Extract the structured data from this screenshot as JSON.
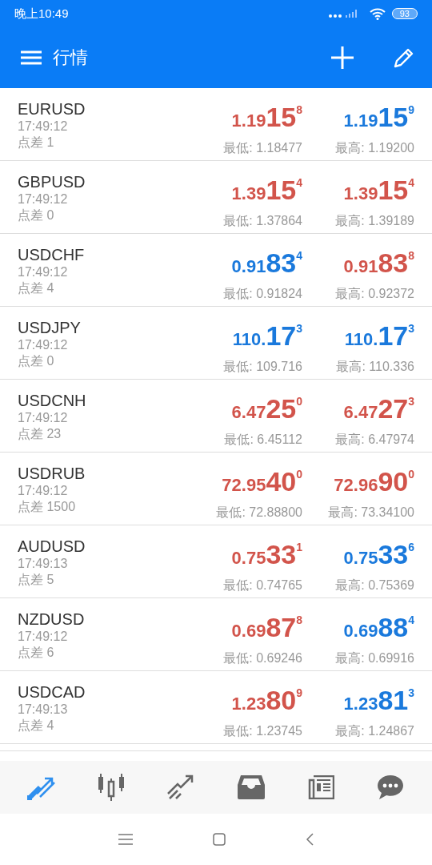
{
  "status_bar": {
    "time": "晚上10:49",
    "battery": "93"
  },
  "app_bar": {
    "title": "行情"
  },
  "quotes": [
    {
      "symbol": "EURUSD",
      "time": "17:49:12",
      "spread": "点差 1",
      "bid": {
        "prefix": "1.19",
        "big": "15",
        "sup": "8",
        "up": false
      },
      "ask": {
        "prefix": "1.19",
        "big": "15",
        "sup": "9",
        "up": true
      },
      "low": "最低: 1.18477",
      "high": "最高: 1.19200"
    },
    {
      "symbol": "GBPUSD",
      "time": "17:49:12",
      "spread": "点差 0",
      "bid": {
        "prefix": "1.39",
        "big": "15",
        "sup": "4",
        "up": false
      },
      "ask": {
        "prefix": "1.39",
        "big": "15",
        "sup": "4",
        "up": false
      },
      "low": "最低: 1.37864",
      "high": "最高: 1.39189"
    },
    {
      "symbol": "USDCHF",
      "time": "17:49:12",
      "spread": "点差 4",
      "bid": {
        "prefix": "0.91",
        "big": "83",
        "sup": "4",
        "up": true
      },
      "ask": {
        "prefix": "0.91",
        "big": "83",
        "sup": "8",
        "up": false
      },
      "low": "最低: 0.91824",
      "high": "最高: 0.92372"
    },
    {
      "symbol": "USDJPY",
      "time": "17:49:12",
      "spread": "点差 0",
      "bid": {
        "prefix": "110.",
        "big": "17",
        "sup": "3",
        "up": true
      },
      "ask": {
        "prefix": "110.",
        "big": "17",
        "sup": "3",
        "up": true
      },
      "low": "最低: 109.716",
      "high": "最高: 110.336"
    },
    {
      "symbol": "USDCNH",
      "time": "17:49:12",
      "spread": "点差 23",
      "bid": {
        "prefix": "6.47",
        "big": "25",
        "sup": "0",
        "up": false
      },
      "ask": {
        "prefix": "6.47",
        "big": "27",
        "sup": "3",
        "up": false
      },
      "low": "最低: 6.45112",
      "high": "最高: 6.47974"
    },
    {
      "symbol": "USDRUB",
      "time": "17:49:12",
      "spread": "点差 1500",
      "bid": {
        "prefix": "72.95",
        "big": "40",
        "sup": "0",
        "up": false
      },
      "ask": {
        "prefix": "72.96",
        "big": "90",
        "sup": "0",
        "up": false
      },
      "low": "最低: 72.88800",
      "high": "最高: 73.34100"
    },
    {
      "symbol": "AUDUSD",
      "time": "17:49:13",
      "spread": "点差 5",
      "bid": {
        "prefix": "0.75",
        "big": "33",
        "sup": "1",
        "up": false
      },
      "ask": {
        "prefix": "0.75",
        "big": "33",
        "sup": "6",
        "up": true
      },
      "low": "最低: 0.74765",
      "high": "最高: 0.75369"
    },
    {
      "symbol": "NZDUSD",
      "time": "17:49:12",
      "spread": "点差 6",
      "bid": {
        "prefix": "0.69",
        "big": "87",
        "sup": "8",
        "up": false
      },
      "ask": {
        "prefix": "0.69",
        "big": "88",
        "sup": "4",
        "up": true
      },
      "low": "最低: 0.69246",
      "high": "最高: 0.69916"
    },
    {
      "symbol": "USDCAD",
      "time": "17:49:13",
      "spread": "点差 4",
      "bid": {
        "prefix": "1.23",
        "big": "80",
        "sup": "9",
        "up": false
      },
      "ask": {
        "prefix": "1.23",
        "big": "81",
        "sup": "3",
        "up": true
      },
      "low": "最低: 1.23745",
      "high": "最高: 1.24867"
    }
  ],
  "bottom_nav": [
    {
      "kind": "quotes",
      "selected": true
    },
    {
      "kind": "chart",
      "selected": false
    },
    {
      "kind": "trade",
      "selected": false
    },
    {
      "kind": "history",
      "selected": false
    },
    {
      "kind": "news",
      "selected": false
    },
    {
      "kind": "chat",
      "selected": false
    }
  ]
}
